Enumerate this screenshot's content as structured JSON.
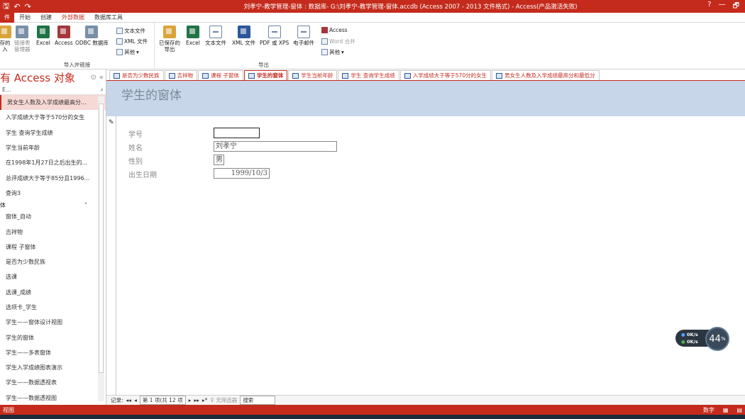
{
  "titlebar": {
    "title": "刘孝宁-教学管理-窗体 : 数据库- G:\\刘孝宁-教学管理-窗体.accdb (Access 2007 - 2013 文件格式) - Access(产品激活失败)",
    "help": "?",
    "minimize": "—",
    "restore": "🗗"
  },
  "menu": {
    "file": "件",
    "tabs": [
      "开始",
      "创建",
      "外部数据",
      "数据库工具"
    ],
    "active_tab": "外部数据"
  },
  "ribbon": {
    "import_group": {
      "label": "导入并链接",
      "saved_imports": "存的\n入",
      "linked_table_manager": "链接表\n管理器",
      "excel": "Excel",
      "access": "Access",
      "odbc": "ODBC 数据库",
      "text_file": "文本文件",
      "xml_file": "XML 文件",
      "more": "其他"
    },
    "export_group": {
      "label": "导出",
      "saved_exports": "已保存的\n导出",
      "excel": "Excel",
      "text_file": "文本文件",
      "xml_file": "XML 文件",
      "pdf_xps": "PDF 或 XPS",
      "email": "电子邮件",
      "access": "Access",
      "word_merge": "Word 合并",
      "more": "其他"
    }
  },
  "navpane": {
    "title": "有 Access 对象",
    "search_placeholder": "E...",
    "queries": [
      "男女生人数及入学成绩最高分...",
      "入学成绩大于等于570分的女生",
      "学生 查询学生成绩",
      "学生当前年龄",
      "在1998年1月27日之后出生的...",
      "总评成绩大于等于85分且1996...",
      "查询3"
    ],
    "forms_group": "体",
    "forms": [
      "窗体_自动",
      "吉祥物",
      "课程 子窗体",
      "是否为少数民族",
      "选课",
      "选课_成绩",
      "选项卡_学生",
      "学生——窗体设计视图",
      "学生的窗体",
      "学生——多表窗体",
      "学生入学成绩图表演示",
      "学生——数据透视表",
      "学生——数据透视图"
    ]
  },
  "doctabs": [
    "是否为少数民族",
    "吉祥物",
    "课程 子窗体",
    "学生的窗体",
    "学生当前年龄",
    "学生 查询学生成绩",
    "入学成绩大于等于570分的女生",
    "男女生人数及入学成绩最高分和最低分"
  ],
  "form": {
    "header_title": "学生的窗体",
    "fields": [
      {
        "label": "学号",
        "value": ""
      },
      {
        "label": "姓名",
        "value": "刘孝宁"
      },
      {
        "label": "性别",
        "value": "男"
      },
      {
        "label": "出生日期",
        "value": "1999/10/3"
      }
    ]
  },
  "recnav": {
    "label": "记录:",
    "first": "◂◂",
    "prev": "◂",
    "position": "第 1 项(共 12 项",
    "next": "▸",
    "last": "▸▸",
    "new": "▸*",
    "filter": "无筛选器",
    "search": "搜索"
  },
  "statusbar": {
    "left": "视图",
    "numlock": "数字"
  },
  "netwidget": {
    "up": "0K/s",
    "down": "0K/s",
    "percent": "44",
    "percent_unit": "%"
  }
}
